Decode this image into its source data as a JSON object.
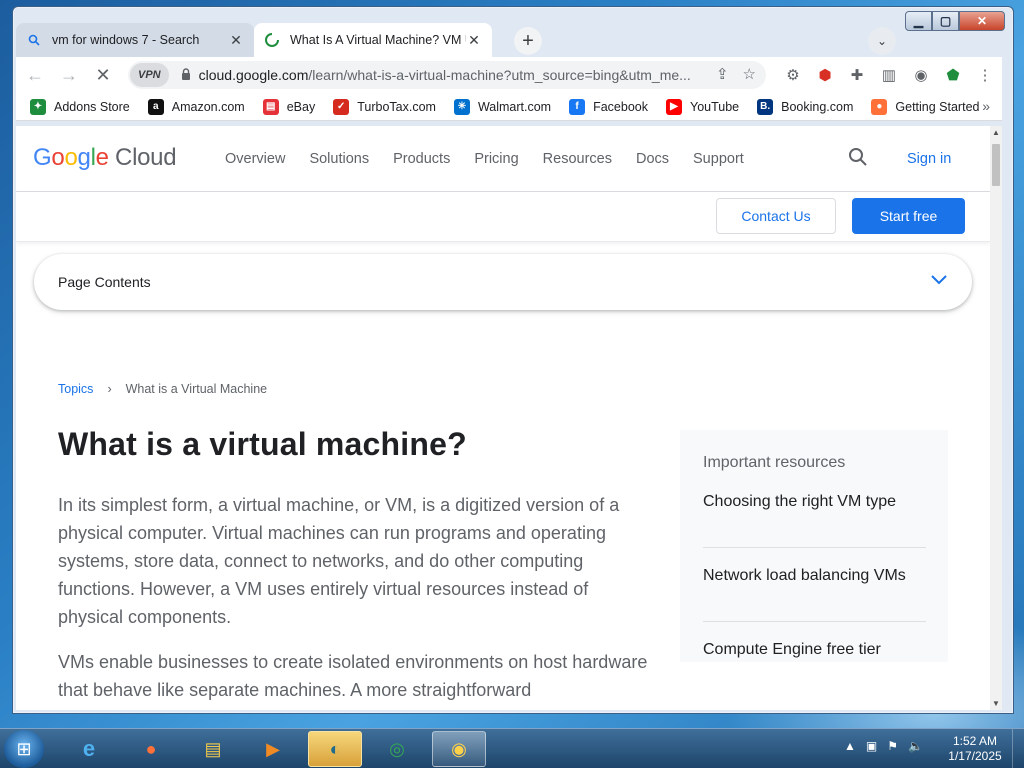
{
  "browser": {
    "tabs": [
      {
        "title": "vm for windows 7 - Search",
        "close": "✕"
      },
      {
        "title": "What Is A Virtual Machine? VM U",
        "close": "✕"
      }
    ],
    "new_tab": "+",
    "omnibox": {
      "vpn_badge": "VPN",
      "url_host": "cloud.google.com",
      "url_rest": "/learn/what-is-a-virtual-machine?utm_source=bing&utm_me..."
    },
    "bookmarks": [
      {
        "label": "Addons Store",
        "color": "#1e8e3e",
        "glyph": "✦"
      },
      {
        "label": "Amazon.com",
        "color": "#111111",
        "glyph": "a"
      },
      {
        "label": "eBay",
        "color": "#e53238",
        "glyph": "▤"
      },
      {
        "label": "TurboTax.com",
        "color": "#d52b1e",
        "glyph": "✓"
      },
      {
        "label": "Walmart.com",
        "color": "#0071ce",
        "glyph": "✳"
      },
      {
        "label": "Facebook",
        "color": "#1877f2",
        "glyph": "f"
      },
      {
        "label": "YouTube",
        "color": "#ff0000",
        "glyph": "▶"
      },
      {
        "label": "Booking.com",
        "color": "#003580",
        "glyph": "B."
      },
      {
        "label": "Getting Started",
        "color": "#ff7139",
        "glyph": "●"
      }
    ]
  },
  "page": {
    "logo_google": "Google",
    "logo_cloud": "Cloud",
    "nav": [
      "Overview",
      "Solutions",
      "Products",
      "Pricing",
      "Resources",
      "Docs",
      "Support"
    ],
    "sign_in": "Sign in",
    "contact_us": "Contact Us",
    "start_free": "Start free",
    "page_contents": "Page Contents",
    "breadcrumb": {
      "link": "Topics",
      "sep": "›",
      "current": "What is a Virtual Machine"
    },
    "title": "What is a virtual machine?",
    "paragraph1": "In its simplest form, a virtual machine, or VM, is a digitized version of a physical computer. Virtual machines can run programs and operating systems, store data, connect to networks, and do other computing functions. However, a VM uses entirely virtual resources instead of physical components.",
    "paragraph2": "VMs enable businesses to create isolated environments on host hardware that behave like separate machines. A more straightforward",
    "resources": {
      "heading": "Important resources",
      "items": [
        "Choosing the right VM type",
        "Network load balancing VMs",
        "Compute Engine free tier"
      ]
    }
  },
  "taskbar": {
    "time": "1:52 AM",
    "date": "1/17/2025"
  },
  "colors": {
    "google_blue": "#4285F4",
    "google_red": "#EA4335",
    "google_yellow": "#FBBC05",
    "google_green": "#34A853",
    "link_blue": "#1a73e8"
  }
}
